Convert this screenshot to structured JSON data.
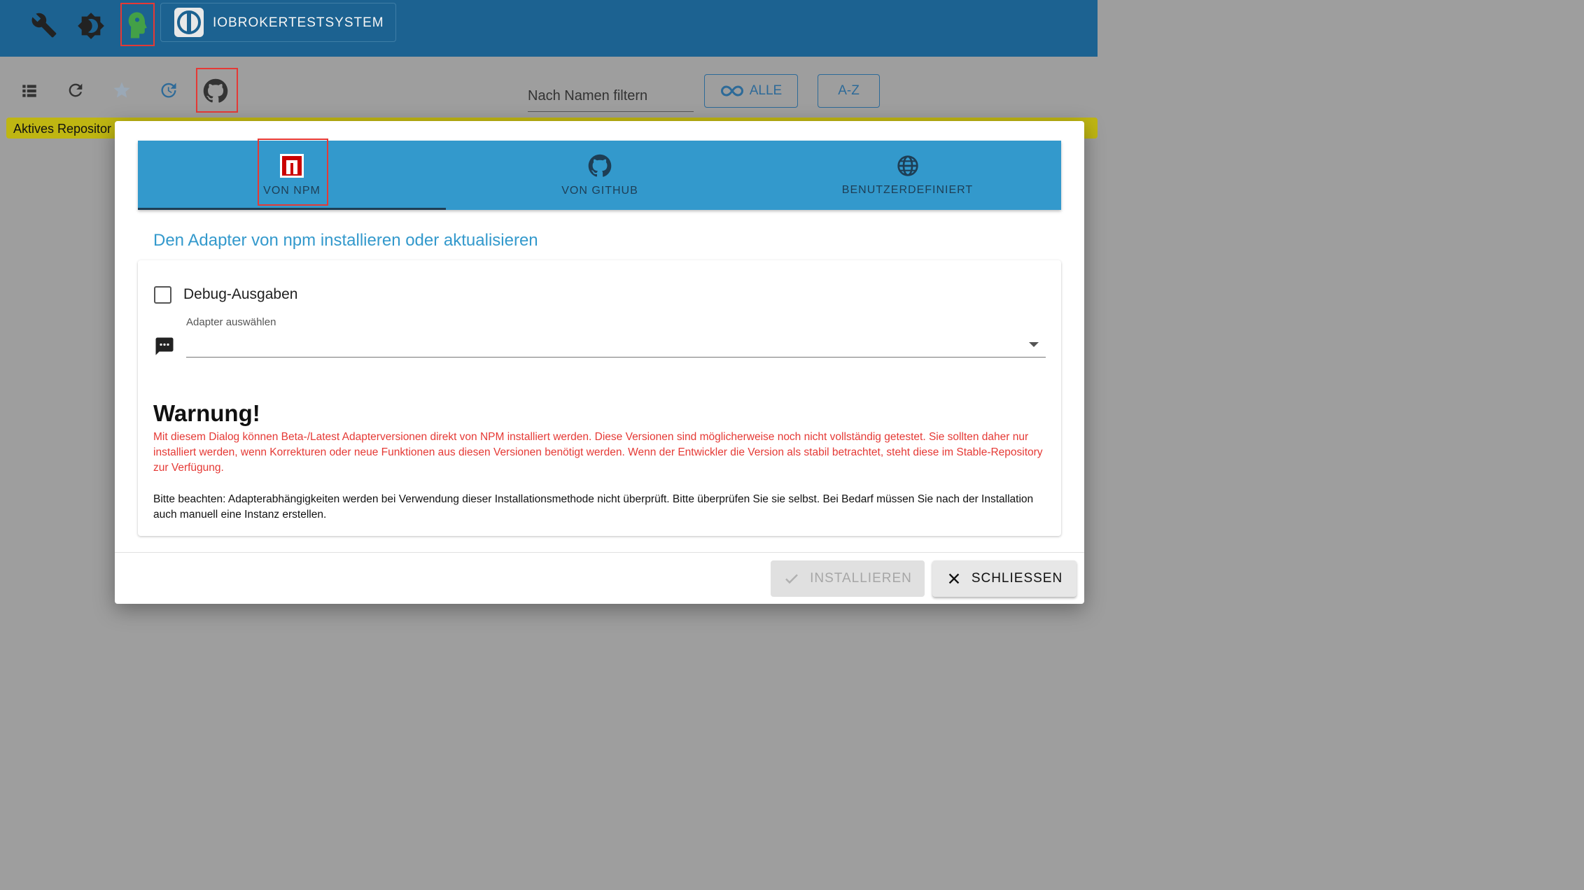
{
  "header": {
    "host_name": "IOBROKERTESTSYSTEM"
  },
  "toolbar": {
    "filter_placeholder": "Nach Namen filtern",
    "all_button": "ALLE",
    "az_button": "A-Z"
  },
  "banner": {
    "text": "Aktives Repositor"
  },
  "dialog": {
    "tabs": [
      {
        "label": "VON NPM",
        "icon": "npm-icon",
        "active": true
      },
      {
        "label": "VON GITHUB",
        "icon": "github-icon",
        "active": false
      },
      {
        "label": "BENUTZERDEFINIERT",
        "icon": "globe-icon",
        "active": false
      }
    ],
    "heading": "Den Adapter von npm installieren oder aktualisieren",
    "debug_label": "Debug-Ausgaben",
    "select_label": "Adapter auswählen",
    "warning_title": "Warnung!",
    "warning_text": "Mit diesem Dialog können Beta-/Latest Adapterversionen direkt von NPM installiert werden. Diese Versionen sind möglicherweise noch nicht vollständig getestet. Sie sollten daher nur installiert werden, wenn Korrekturen oder neue Funktionen aus diesen Versionen benötigt werden. Wenn der Entwickler die Version als stabil betrachtet, steht diese im Stable-Repository zur Verfügung.",
    "note_text": "Bitte beachten: Adapterabhängigkeiten werden bei Verwendung dieser Installationsmethode nicht überprüft. Bitte überprüfen Sie sie selbst. Bei Bedarf müssen Sie nach der Installation auch manuell eine Instanz erstellen.",
    "install_button": "INSTALLIEREN",
    "close_button": "SCHLIESSEN"
  },
  "colors": {
    "header_bg": "#1c6291",
    "tab_bg": "#3399cc",
    "warning": "#e53935",
    "highlight": "#e53935",
    "banner": "#bfb612"
  }
}
